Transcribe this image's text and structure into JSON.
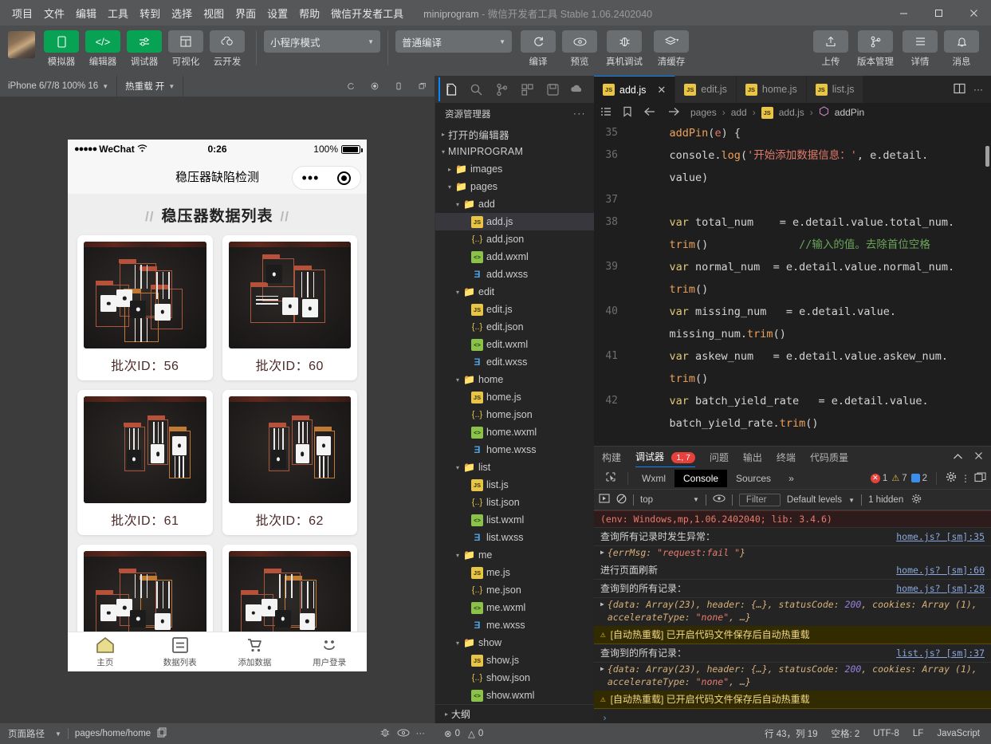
{
  "titlebar": {
    "menus": [
      "项目",
      "文件",
      "编辑",
      "工具",
      "转到",
      "选择",
      "视图",
      "界面",
      "设置",
      "帮助",
      "微信开发者工具"
    ],
    "project": "miniprogram",
    "version": "- 微信开发者工具 Stable 1.06.2402040",
    "minimize": "−",
    "maximize": "▢",
    "close": "✕"
  },
  "toolbar": {
    "left_items": [
      {
        "label": "模拟器",
        "icon": "phone-icon",
        "style": "green"
      },
      {
        "label": "编辑器",
        "icon": "code-icon",
        "style": "green"
      },
      {
        "label": "调试器",
        "icon": "sliders-icon",
        "style": "green"
      },
      {
        "label": "可视化",
        "icon": "layout-icon",
        "style": "grey"
      },
      {
        "label": "云开发",
        "icon": "cloud-icon",
        "style": "grey"
      }
    ],
    "mode_select": "小程序模式",
    "compile_select": "普通编译",
    "mid_items": [
      {
        "label": "编译",
        "icon": "refresh-icon"
      },
      {
        "label": "预览",
        "icon": "eye-icon"
      },
      {
        "label": "真机调试",
        "icon": "bug-icon"
      },
      {
        "label": "清缓存",
        "icon": "layers-icon"
      }
    ],
    "right_items": [
      {
        "label": "上传",
        "icon": "upload-icon"
      },
      {
        "label": "版本管理",
        "icon": "branch-icon"
      },
      {
        "label": "详情",
        "icon": "menu-icon"
      },
      {
        "label": "消息",
        "icon": "bell-icon"
      }
    ]
  },
  "simulator": {
    "device": "iPhone 6/7/8 100% 16",
    "hot_reload": "热重载 开",
    "icons": [
      "rotate-icon",
      "record-icon",
      "device-icon",
      "windows-icon"
    ],
    "phone": {
      "carrier": "WeChat",
      "time": "0:26",
      "battery_pct": "100%",
      "nav_title": "稳压器缺陷检测",
      "page_title": "稳压器数据列表",
      "slash": "//",
      "cards": [
        {
          "label": "批次ID：56"
        },
        {
          "label": "批次ID：60"
        },
        {
          "label": "批次ID：61"
        },
        {
          "label": "批次ID：62"
        },
        {
          "label": ""
        },
        {
          "label": ""
        }
      ],
      "tabbar": [
        {
          "label": "主页",
          "icon": "home-icon"
        },
        {
          "label": "数据列表",
          "icon": "list-icon"
        },
        {
          "label": "添加数据",
          "icon": "cart-icon"
        },
        {
          "label": "用户登录",
          "icon": "smiley-icon"
        }
      ]
    }
  },
  "explorer": {
    "activity_icons": [
      "files-icon",
      "search-icon",
      "source-control-icon",
      "extensions-icon",
      "save-icon",
      "cloud-dev-icon"
    ],
    "title": "资源管理器",
    "more": "···",
    "sections": [
      "打开的编辑器",
      "MINIPROGRAM"
    ],
    "outline": "大纲",
    "tree": [
      {
        "name": "打开的编辑器",
        "depth": 0,
        "type": "section",
        "arrow": "▸"
      },
      {
        "name": "MINIPROGRAM",
        "depth": 0,
        "type": "section",
        "arrow": "▾"
      },
      {
        "name": "images",
        "depth": 1,
        "type": "folder-img",
        "arrow": "▸"
      },
      {
        "name": "pages",
        "depth": 1,
        "type": "folder-pages",
        "arrow": "▾"
      },
      {
        "name": "add",
        "depth": 2,
        "type": "folder",
        "arrow": "▾"
      },
      {
        "name": "add.js",
        "depth": 3,
        "type": "js",
        "selected": true
      },
      {
        "name": "add.json",
        "depth": 3,
        "type": "json"
      },
      {
        "name": "add.wxml",
        "depth": 3,
        "type": "wxml"
      },
      {
        "name": "add.wxss",
        "depth": 3,
        "type": "wxss"
      },
      {
        "name": "edit",
        "depth": 2,
        "type": "folder",
        "arrow": "▾"
      },
      {
        "name": "edit.js",
        "depth": 3,
        "type": "js"
      },
      {
        "name": "edit.json",
        "depth": 3,
        "type": "json"
      },
      {
        "name": "edit.wxml",
        "depth": 3,
        "type": "wxml"
      },
      {
        "name": "edit.wxss",
        "depth": 3,
        "type": "wxss"
      },
      {
        "name": "home",
        "depth": 2,
        "type": "folder",
        "arrow": "▾"
      },
      {
        "name": "home.js",
        "depth": 3,
        "type": "js"
      },
      {
        "name": "home.json",
        "depth": 3,
        "type": "json"
      },
      {
        "name": "home.wxml",
        "depth": 3,
        "type": "wxml"
      },
      {
        "name": "home.wxss",
        "depth": 3,
        "type": "wxss"
      },
      {
        "name": "list",
        "depth": 2,
        "type": "folder",
        "arrow": "▾"
      },
      {
        "name": "list.js",
        "depth": 3,
        "type": "js"
      },
      {
        "name": "list.json",
        "depth": 3,
        "type": "json"
      },
      {
        "name": "list.wxml",
        "depth": 3,
        "type": "wxml"
      },
      {
        "name": "list.wxss",
        "depth": 3,
        "type": "wxss"
      },
      {
        "name": "me",
        "depth": 2,
        "type": "folder",
        "arrow": "▾"
      },
      {
        "name": "me.js",
        "depth": 3,
        "type": "js"
      },
      {
        "name": "me.json",
        "depth": 3,
        "type": "json"
      },
      {
        "name": "me.wxml",
        "depth": 3,
        "type": "wxml"
      },
      {
        "name": "me.wxss",
        "depth": 3,
        "type": "wxss"
      },
      {
        "name": "show",
        "depth": 2,
        "type": "folder",
        "arrow": "▾"
      },
      {
        "name": "show.js",
        "depth": 3,
        "type": "js"
      },
      {
        "name": "show.json",
        "depth": 3,
        "type": "json"
      },
      {
        "name": "show.wxml",
        "depth": 3,
        "type": "wxml"
      }
    ]
  },
  "editor": {
    "tabs": [
      {
        "label": "add.js",
        "active": true,
        "closable": true
      },
      {
        "label": "edit.js",
        "active": false
      },
      {
        "label": "home.js",
        "active": false
      },
      {
        "label": "list.js",
        "active": false
      }
    ],
    "tab_actions": [
      "split-editor-icon",
      "more-icon"
    ],
    "breadcrumb_icons": [
      "outline-icon",
      "bookmark-icon",
      "back-arrow-icon",
      "forward-arrow-icon"
    ],
    "breadcrumb": [
      "pages",
      "add",
      "add.js",
      "addPin"
    ],
    "lines": [
      {
        "no": "35",
        "segments": [
          {
            "t": "    ",
            "c": "pl"
          },
          {
            "t": "addPin",
            "c": "fn"
          },
          {
            "t": "(",
            "c": "pl"
          },
          {
            "t": "e",
            "c": "str"
          },
          {
            "t": ") {",
            "c": "pl"
          }
        ]
      },
      {
        "no": "36",
        "segments": [
          {
            "t": "    console.",
            "c": "pl"
          },
          {
            "t": "log",
            "c": "fn"
          },
          {
            "t": "(",
            "c": "pl"
          },
          {
            "t": "'开始添加数据信息：'",
            "c": "str"
          },
          {
            "t": ", e.detail.",
            "c": "pl"
          }
        ]
      },
      {
        "no": "",
        "segments": [
          {
            "t": "    value)",
            "c": "pl"
          }
        ]
      },
      {
        "no": "37",
        "segments": [
          {
            "t": "",
            "c": "pl"
          }
        ]
      },
      {
        "no": "38",
        "segments": [
          {
            "t": "    ",
            "c": "pl"
          },
          {
            "t": "var",
            "c": "kw"
          },
          {
            "t": " total_num    = e.detail.value.total_num.",
            "c": "pl"
          }
        ]
      },
      {
        "no": "",
        "segments": [
          {
            "t": "    ",
            "c": "pl"
          },
          {
            "t": "trim",
            "c": "fn"
          },
          {
            "t": "()",
            "c": "pl"
          },
          {
            "t": "              ",
            "c": "pl"
          },
          {
            "t": "//输入的值。去除首位空格",
            "c": "cm"
          }
        ]
      },
      {
        "no": "39",
        "segments": [
          {
            "t": "    ",
            "c": "pl"
          },
          {
            "t": "var",
            "c": "kw"
          },
          {
            "t": " normal_num  = e.detail.value.normal_num.",
            "c": "pl"
          }
        ]
      },
      {
        "no": "",
        "segments": [
          {
            "t": "    ",
            "c": "pl"
          },
          {
            "t": "trim",
            "c": "fn"
          },
          {
            "t": "()",
            "c": "pl"
          }
        ]
      },
      {
        "no": "40",
        "segments": [
          {
            "t": "    ",
            "c": "pl"
          },
          {
            "t": "var",
            "c": "kw"
          },
          {
            "t": " missing_num   = e.detail.value.",
            "c": "pl"
          }
        ]
      },
      {
        "no": "",
        "segments": [
          {
            "t": "    missing_num.",
            "c": "pl"
          },
          {
            "t": "trim",
            "c": "fn"
          },
          {
            "t": "()",
            "c": "pl"
          }
        ]
      },
      {
        "no": "41",
        "segments": [
          {
            "t": "    ",
            "c": "pl"
          },
          {
            "t": "var",
            "c": "kw"
          },
          {
            "t": " askew_num   = e.detail.value.askew_num.",
            "c": "pl"
          }
        ]
      },
      {
        "no": "",
        "segments": [
          {
            "t": "    ",
            "c": "pl"
          },
          {
            "t": "trim",
            "c": "fn"
          },
          {
            "t": "()",
            "c": "pl"
          }
        ]
      },
      {
        "no": "42",
        "segments": [
          {
            "t": "    ",
            "c": "pl"
          },
          {
            "t": "var",
            "c": "kw"
          },
          {
            "t": " batch_yield_rate   = e.detail.value.",
            "c": "pl"
          }
        ]
      },
      {
        "no": "",
        "segments": [
          {
            "t": "    batch_yield_rate.",
            "c": "pl"
          },
          {
            "t": "trim",
            "c": "fn"
          },
          {
            "t": "()",
            "c": "pl"
          }
        ]
      }
    ]
  },
  "debugger": {
    "tabs": [
      {
        "label": "构建",
        "sel": false
      },
      {
        "label": "调试器",
        "sel": true,
        "badge": "1, 7"
      },
      {
        "label": "问题",
        "sel": false
      },
      {
        "label": "输出",
        "sel": false
      },
      {
        "label": "终端",
        "sel": false
      },
      {
        "label": "代码质量",
        "sel": false
      }
    ],
    "panel_actions": [
      "collapse-icon",
      "close-icon"
    ],
    "devtools_tabs": [
      {
        "label": "Wxml",
        "sel": false
      },
      {
        "label": "Console",
        "sel": true
      },
      {
        "label": "Sources",
        "sel": false
      },
      {
        "label": "»",
        "sel": false
      }
    ],
    "counts": {
      "errors": "1",
      "warnings": "7",
      "infos": "2"
    },
    "devtools_actions": [
      "settings-icon",
      "more-vertical-icon",
      "dock-icon"
    ],
    "filterbar": {
      "execute_icon": "execute-icon",
      "clear_icon": "clear-console-icon",
      "context": "top",
      "eye_icon": "eye-icon",
      "filter_placeholder": "Filter",
      "levels": "Default levels",
      "hidden": "1 hidden",
      "gear_icon": "gear-icon"
    },
    "messages": [
      {
        "kind": "env",
        "text": "(env: Windows,mp,1.06.2402040; lib: 3.4.6)"
      },
      {
        "kind": "log",
        "text": "查询所有记录时发生异常：",
        "source": "home.js? [sm]:35"
      },
      {
        "kind": "detail",
        "text": "{errMsg: \"request:fail \"}",
        "expandable": true
      },
      {
        "kind": "log",
        "text": "进行页面刷新",
        "source": "home.js? [sm]:60"
      },
      {
        "kind": "log",
        "text": "查询到的所有记录：",
        "source": "home.js? [sm]:28"
      },
      {
        "kind": "detail",
        "text": "{data: Array(23), header: {…}, statusCode: 200, cookies: Array (1), accelerateType: \"none\", …}",
        "expandable": true
      },
      {
        "kind": "warn",
        "text": "[自动热重载] 已开启代码文件保存后自动热重载"
      },
      {
        "kind": "log",
        "text": "查询到的所有记录：",
        "source": "list.js? [sm]:37"
      },
      {
        "kind": "detail",
        "text": "{data: Array(23), header: {…}, statusCode: 200, cookies: Array (1), accelerateType: \"none\", …}",
        "expandable": true
      },
      {
        "kind": "warn",
        "text": "[自动热重载] 已开启代码文件保存后自动热重载"
      },
      {
        "kind": "prompt",
        "text": "›"
      }
    ]
  },
  "statusbar": {
    "page_path_label": "页面路径",
    "page_path": "pages/home/home",
    "copy_icon": "copy-icon",
    "left_icons": [
      "bug-icon",
      "eye-icon",
      "more-icon"
    ],
    "problems": "⊗ 0  ⚠ 0",
    "error_count": "0",
    "warning_count": "0",
    "cursor": "行 43，列 19",
    "indent": "空格: 2",
    "encoding": "UTF-8",
    "eol": "LF",
    "language": "JavaScript"
  }
}
